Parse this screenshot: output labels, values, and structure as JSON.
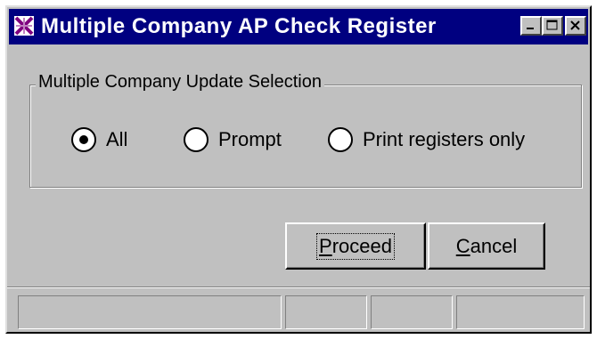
{
  "window": {
    "title": "Multiple Company AP Check Register",
    "controls": {
      "minimize_icon": "minimize-icon",
      "maximize_icon": "maximize-icon",
      "close_icon": "close-icon"
    }
  },
  "group": {
    "label": "Multiple Company Update Selection",
    "options": [
      {
        "label": "All",
        "selected": true
      },
      {
        "label": "Prompt",
        "selected": false
      },
      {
        "label": "Print registers only",
        "selected": false
      }
    ]
  },
  "buttons": {
    "proceed": {
      "label_underlined": "P",
      "label_rest": "roceed"
    },
    "cancel": {
      "label_underlined": "C",
      "label_rest": "ancel"
    }
  },
  "status_panels": [
    "",
    "",
    "",
    ""
  ],
  "colors": {
    "titlebar": "#000080",
    "face": "#c0c0c0"
  }
}
